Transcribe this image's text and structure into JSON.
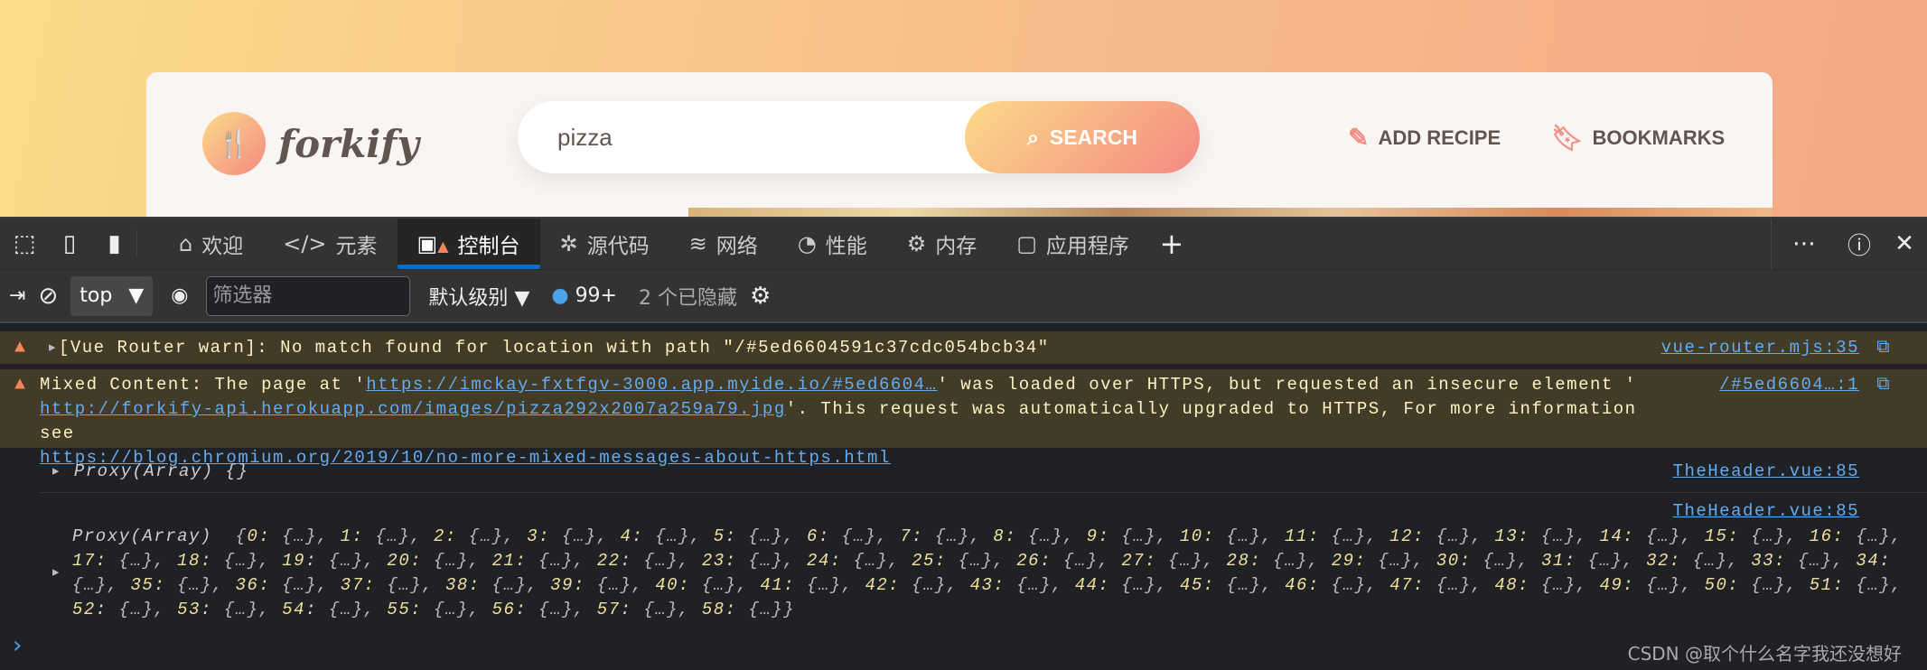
{
  "app": {
    "logo_text": "forkify",
    "search_value": "pizza",
    "search_button": "SEARCH",
    "add_recipe": "ADD RECIPE",
    "bookmarks": "BOOKMARKS",
    "brand_gradient": [
      "#fbdb89",
      "#f48982"
    ]
  },
  "devtools": {
    "tabs": [
      {
        "label": "欢迎",
        "icon": "home-icon"
      },
      {
        "label": "元素",
        "icon": "code-icon"
      },
      {
        "label": "控制台",
        "icon": "console-icon",
        "active": true
      },
      {
        "label": "源代码",
        "icon": "bug-icon"
      },
      {
        "label": "网络",
        "icon": "wifi-icon"
      },
      {
        "label": "性能",
        "icon": "gauge-icon"
      },
      {
        "label": "内存",
        "icon": "chip-icon"
      },
      {
        "label": "应用程序",
        "icon": "window-icon"
      }
    ],
    "toolbar": {
      "context": "top",
      "filter_placeholder": "筛选器",
      "level": "默认级别",
      "message_count": "99+",
      "hidden": "2 个已隐藏"
    },
    "messages": [
      {
        "type": "warning",
        "text": "[Vue Router warn]: No match found for location with path \"/#5ed6604591c37cdc054bcb34\"",
        "source": "vue-router.mjs:35"
      },
      {
        "type": "warning",
        "prefix": "Mixed Content: The page at '",
        "link1": "https://imckay-fxtfgv-3000.app.myide.io/#5ed6604…",
        "mid": "' was loaded over HTTPS, but requested an insecure element '",
        "link2": "http://forkify-api.herokuapp.com/images/pizza292x2007a259a79.jpg",
        "mid2": "'. This request was automatically upgraded to HTTPS, For more information see",
        "link3": "https://blog.chromium.org/2019/10/no-more-mixed-messages-about-https.html",
        "source": "/#5ed6604…:1"
      },
      {
        "type": "log",
        "text": "Proxy(Array)  {}",
        "source": "TheHeader.vue:85"
      },
      {
        "type": "log",
        "label": "Proxy(Array)",
        "source": "TheHeader.vue:85",
        "count": 59
      }
    ],
    "watermark": "CSDN @取个什么名字我还没想好"
  }
}
